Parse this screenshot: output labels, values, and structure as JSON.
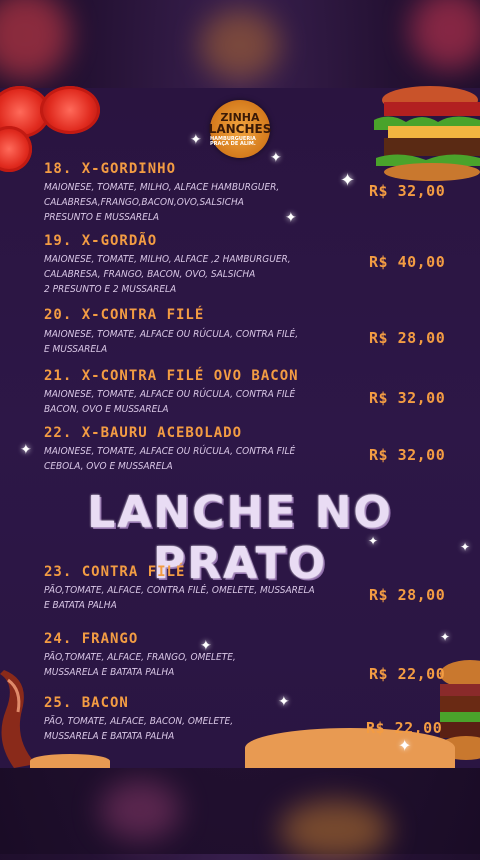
{
  "logo": {
    "line1": "ZINHA",
    "line2": "LANCHES",
    "tagline": "HAMBURGUERIA PRAÇA DE ALIM."
  },
  "items": [
    {
      "title": "18. X-GORDINHO",
      "desc": [
        "MAIONESE, TOMATE, MILHO, ALFACE HAMBURGUER,",
        "CALABRESA,FRANGO,BACON,OVO,SALSICHA",
        "PRESUNTO E MUSSARELA"
      ],
      "price": "R$ 32,00"
    },
    {
      "title": "19. X-GORDÃO",
      "desc": [
        "MAIONESE, TOMATE, MILHO, ALFACE ,2 HAMBURGUER,",
        "CALABRESA, FRANGO, BACON, OVO, SALSICHA",
        "2 PRESUNTO E 2 MUSSARELA"
      ],
      "price": "R$ 40,00"
    },
    {
      "title": "20. X-CONTRA FILÉ",
      "desc": [
        "MAIONESE, TOMATE, ALFACE OU RÚCULA, CONTRA FILÉ,",
        "E MUSSARELA"
      ],
      "price": "R$ 28,00"
    },
    {
      "title": "21. X-CONTRA FILÉ OVO BACON",
      "desc": [
        "MAIONESE, TOMATE, ALFACE OU RÚCULA, CONTRA FILÉ",
        "BACON, OVO E MUSSARELA"
      ],
      "price": "R$ 32,00"
    },
    {
      "title": "22. X-BAURU ACEBOLADO",
      "desc": [
        "MAIONESE, TOMATE, ALFACE OU RÚCULA, CONTRA FILÉ",
        "CEBOLA, OVO E MUSSARELA"
      ],
      "price": "R$ 32,00"
    }
  ],
  "section": {
    "title": "LANCHE NO PRATO"
  },
  "plates": [
    {
      "title": "23. CONTRA FILÉ",
      "desc": [
        "PÃO,TOMATE, ALFACE, CONTRA FILÉ, OMELETE, MUSSARELA",
        "E BATATA PALHA"
      ],
      "price": "R$ 28,00"
    },
    {
      "title": "24. FRANGO",
      "desc": [
        "PÃO,TOMATE, ALFACE, FRANGO, OMELETE,",
        "MUSSARELA E BATATA PALHA"
      ],
      "price": "R$ 22,00"
    },
    {
      "title": "25. BACON",
      "desc": [
        "PÃO, TOMATE, ALFACE, BACON, OMELETE,",
        "MUSSARELA E BATATA PALHA"
      ],
      "price": "R$ 22,00"
    }
  ],
  "colors": {
    "accent": "#f39c43",
    "text": "#d9c7e6",
    "background": "#2a1440"
  }
}
